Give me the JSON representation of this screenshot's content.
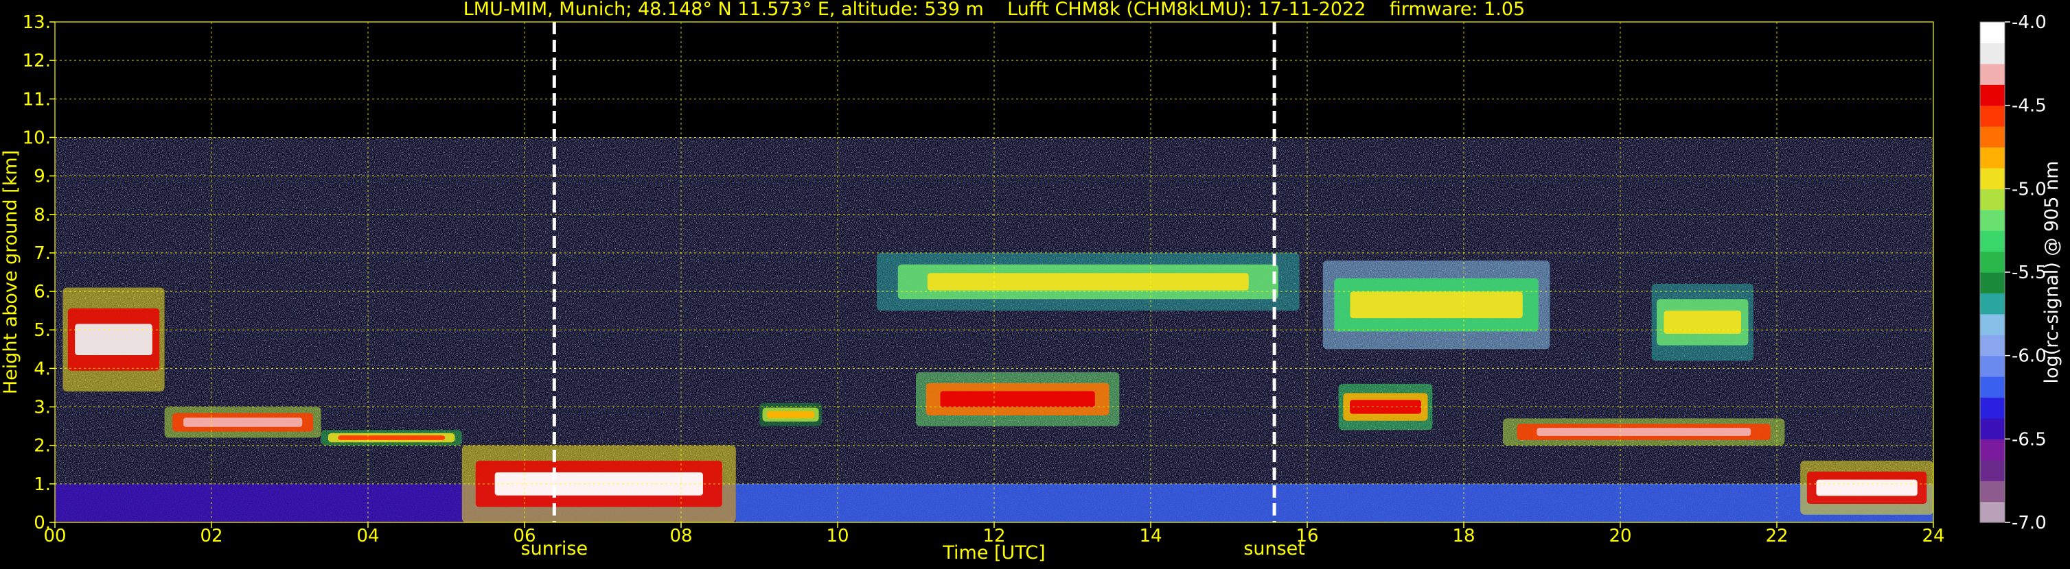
{
  "chart_data": {
    "type": "heatmap",
    "title": "LMU-MIM, Munich; 48.148° N 11.573° E, altitude: 539 m    Lufft CHM8k (CHM8kLMU): 17-11-2022    firmware: 1.05",
    "xlabel": "Time [UTC]",
    "ylabel": "Height above ground [km]",
    "xlim": [
      0,
      24
    ],
    "ylim": [
      0,
      13
    ],
    "x_ticks": [
      0,
      2,
      4,
      6,
      8,
      10,
      12,
      14,
      16,
      18,
      20,
      22,
      24
    ],
    "x_tick_labels": [
      "00",
      "02",
      "04",
      "06",
      "08",
      "10",
      "12",
      "14",
      "16",
      "18",
      "20",
      "22",
      "24"
    ],
    "y_ticks": [
      0,
      1,
      2,
      3,
      4,
      5,
      6,
      7,
      8,
      9,
      10,
      11,
      12,
      13
    ],
    "y_tick_labels": [
      "0.",
      "1.",
      "2.",
      "3.",
      "4.",
      "5.",
      "6.",
      "7.",
      "8.",
      "9.",
      "10.",
      "11.",
      "12.",
      "13."
    ],
    "grid": true,
    "data_max_height": 10,
    "markers": [
      {
        "label": "sunrise",
        "x": 6.38
      },
      {
        "label": "sunset",
        "x": 15.58
      }
    ],
    "colorbar": {
      "label": "log(rc-signal) @ 905 nm",
      "range": [
        -7.0,
        -4.0
      ],
      "ticks": [
        -4.0,
        -4.5,
        -5.0,
        -5.5,
        -6.0,
        -6.5,
        -7.0
      ],
      "tick_labels": [
        "-4.0",
        "-4.5",
        "-5.0",
        "-5.5",
        "-6.0",
        "-6.5",
        "-7.0"
      ],
      "colors": [
        "#b9a2b9",
        "#8c5a8c",
        "#6a2a8c",
        "#7a1a9c",
        "#3a10b8",
        "#2a20e0",
        "#3a60f0",
        "#6a8af0",
        "#8aa6ee",
        "#86c0e8",
        "#2aa6a0",
        "#1a8a3a",
        "#2ab84a",
        "#3ad86a",
        "#6ae070",
        "#b0e040",
        "#f0e020",
        "#ffb000",
        "#ff7000",
        "#ff3a00",
        "#e80000",
        "#f2b0b0",
        "#ececec",
        "#ffffff"
      ]
    },
    "features": [
      {
        "kind": "boundary-layer-aerosol",
        "x": [
          0,
          8.7
        ],
        "height": [
          0,
          1.0
        ],
        "level": -6.4
      },
      {
        "kind": "boundary-layer-aerosol",
        "x": [
          8.7,
          24
        ],
        "height": [
          0,
          1.0
        ],
        "level": -6.2
      },
      {
        "kind": "cloud-layer",
        "x": [
          0.1,
          1.4
        ],
        "height": [
          3.4,
          6.1
        ],
        "level": -4.2
      },
      {
        "kind": "cloud-layer",
        "x": [
          1.4,
          3.4
        ],
        "height": [
          2.2,
          3.0
        ],
        "level": -4.3
      },
      {
        "kind": "cloud-layer",
        "x": [
          3.4,
          5.2
        ],
        "height": [
          2.0,
          2.4
        ],
        "level": -4.6
      },
      {
        "kind": "cloud-layer",
        "x": [
          5.2,
          8.7
        ],
        "height": [
          0,
          2.0
        ],
        "level": -4.1
      },
      {
        "kind": "cloud-layer",
        "x": [
          9.0,
          9.8
        ],
        "height": [
          2.5,
          3.1
        ],
        "level": -4.8
      },
      {
        "kind": "cloud-layer",
        "x": [
          11.0,
          13.6
        ],
        "height": [
          2.5,
          3.9
        ],
        "level": -4.4
      },
      {
        "kind": "cloud-layer",
        "x": [
          10.5,
          15.9
        ],
        "height": [
          5.5,
          7.0
        ],
        "level": -4.9
      },
      {
        "kind": "cloud-layer",
        "x": [
          16.4,
          17.6
        ],
        "height": [
          2.4,
          3.6
        ],
        "level": -4.5
      },
      {
        "kind": "cloud-layer",
        "x": [
          16.2,
          19.1
        ],
        "height": [
          4.5,
          6.8
        ],
        "level": -5.0
      },
      {
        "kind": "cloud-layer",
        "x": [
          18.5,
          22.1
        ],
        "height": [
          2.0,
          2.7
        ],
        "level": -4.3
      },
      {
        "kind": "cloud-layer",
        "x": [
          20.4,
          21.7
        ],
        "height": [
          4.2,
          6.2
        ],
        "level": -4.9
      },
      {
        "kind": "cloud-layer",
        "x": [
          22.3,
          24.0
        ],
        "height": [
          0.2,
          1.6
        ],
        "level": -4.1
      }
    ]
  }
}
